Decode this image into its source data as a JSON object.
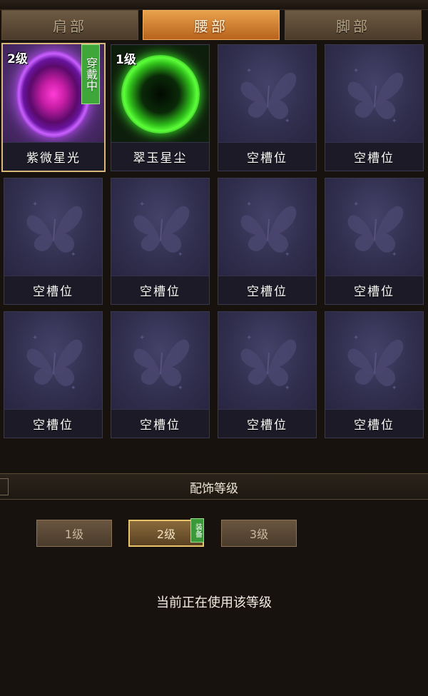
{
  "tabs": [
    {
      "label": "肩部",
      "active": false
    },
    {
      "label": "腰部",
      "active": true
    },
    {
      "label": "脚部",
      "active": false
    }
  ],
  "slots": [
    {
      "name": "紫微星光",
      "level": "2级",
      "wearing": "穿戴中",
      "icon": "purple-star-orb"
    },
    {
      "name": "翠玉星尘",
      "level": "1级",
      "icon": "green-star-orb"
    },
    {
      "name": "空槽位",
      "icon": "butterfly-placeholder"
    },
    {
      "name": "空槽位",
      "icon": "butterfly-placeholder"
    },
    {
      "name": "空槽位",
      "icon": "butterfly-placeholder"
    },
    {
      "name": "空槽位",
      "icon": "butterfly-placeholder"
    },
    {
      "name": "空槽位",
      "icon": "butterfly-placeholder"
    },
    {
      "name": "空槽位",
      "icon": "butterfly-placeholder"
    },
    {
      "name": "空槽位",
      "icon": "butterfly-placeholder"
    },
    {
      "name": "空槽位",
      "icon": "butterfly-placeholder"
    },
    {
      "name": "空槽位",
      "icon": "butterfly-placeholder"
    },
    {
      "name": "空槽位",
      "icon": "butterfly-placeholder"
    }
  ],
  "section": {
    "title": "配饰等级"
  },
  "levels": [
    {
      "label": "1级",
      "active": false
    },
    {
      "label": "2级",
      "active": true
    },
    {
      "label": "3级",
      "active": false
    }
  ],
  "equip_tag": "装备",
  "status": "当前正在使用该等级",
  "colors": {
    "accent_orange": "#e8a24c",
    "wearing_green": "#3fa63a",
    "slot_bg": "#302e4c",
    "panel_bg": "#17120d"
  }
}
